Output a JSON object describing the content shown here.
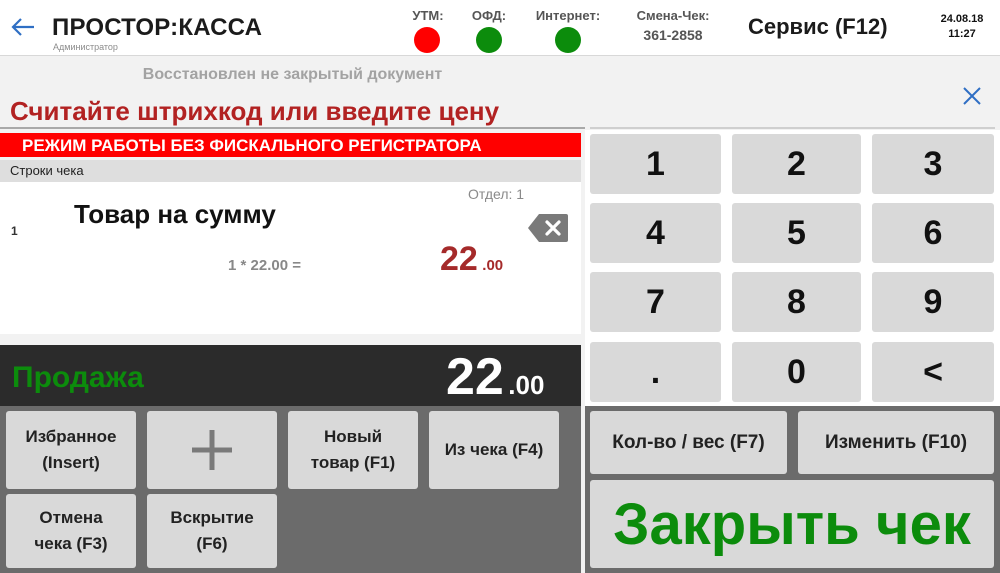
{
  "header": {
    "app_title": "ПРОСТОР:КАССА",
    "role": "Администратор",
    "statuses": [
      {
        "label": "УТМ:",
        "color": "#ff0000"
      },
      {
        "label": "ОФД:",
        "color": "#0c8c0c"
      },
      {
        "label": "Интернет:",
        "color": "#0c8c0c"
      }
    ],
    "shift_label": "Смена-Чек:",
    "shift_value": "361-2858",
    "service_button": "Сервис (F12)",
    "date": "24.08.18",
    "time": "11:27"
  },
  "document": {
    "restored_notice": "Восстановлен не закрытый документ",
    "prompt": "Считайте штрихкод или введите цену",
    "mode_banner": "РЕЖИМ РАБОТЫ БЕЗ ФИСКАЛЬНОГО РЕГИСТРАТОРА",
    "rows_header": "Строки чека"
  },
  "line_items": [
    {
      "number": "1",
      "department": "Отдел: 1",
      "name": "Товар на сумму",
      "calc": "1 * 22.00 =",
      "total_int": "22",
      "total_frac": ".00"
    }
  ],
  "summary": {
    "operation": "Продажа",
    "total_int": "22",
    "total_frac": ".00"
  },
  "actions": {
    "favorites_line1": "Избранное",
    "favorites_line2": "(Insert)",
    "add": "+",
    "new_item_line1": "Новый",
    "new_item_line2": "товар (F1)",
    "from_receipt": "Из чека (F4)",
    "cancel_line1": "Отмена",
    "cancel_line2": "чека (F3)",
    "open_line1": "Вскрытие",
    "open_line2": "(F6)"
  },
  "keypad": {
    "keys": [
      "1",
      "2",
      "3",
      "4",
      "5",
      "6",
      "7",
      "8",
      "9",
      ".",
      "0",
      "<"
    ]
  },
  "functions": {
    "qty_weight": "Кол-во / вес (F7)",
    "edit": "Изменить (F10)",
    "close_check": "Закрыть чек"
  },
  "colors": {
    "accent_red": "#b22222",
    "banner_red": "#ff0000",
    "ok_green": "#0c8c0c",
    "dark_panel": "#2b2b2b",
    "key_grey": "#d9d9d9"
  }
}
